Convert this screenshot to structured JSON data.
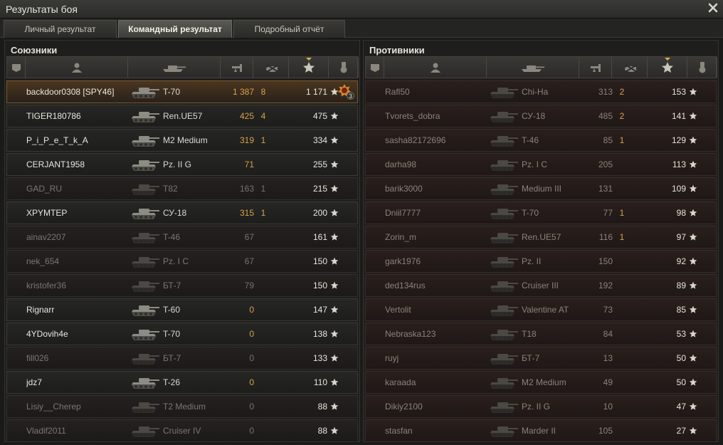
{
  "window": {
    "title": "Результаты боя",
    "close_icon": "close-icon"
  },
  "tabs": [
    {
      "label": "Личный результат",
      "active": false
    },
    {
      "label": "Командный результат",
      "active": true
    },
    {
      "label": "Подробный отчёт",
      "active": false
    }
  ],
  "columns": {
    "icons": [
      "platoon-icon",
      "player-icon",
      "vehicle-icon",
      "damage-icon",
      "kills-icon",
      "xp-icon",
      "medal-icon"
    ],
    "sorted_by": "xp"
  },
  "allies": {
    "title": "Союзники",
    "rows": [
      {
        "player": "backdoor0308 [SPY46]",
        "vehicle": "T-70",
        "damage": "1 387",
        "kills": "8",
        "xp": "1 171",
        "medal": "3",
        "self": true,
        "alive": true
      },
      {
        "player": "TIGER180786",
        "vehicle": "Ren.UE57",
        "damage": "425",
        "kills": "4",
        "xp": "475",
        "alive": true
      },
      {
        "player": "P_i_P_e_T_k_A",
        "vehicle": "M2 Medium",
        "damage": "319",
        "kills": "1",
        "xp": "334",
        "alive": true
      },
      {
        "player": "CERJANT1958",
        "vehicle": "Pz. II G",
        "damage": "71",
        "kills": "",
        "xp": "255",
        "alive": true
      },
      {
        "player": "GAD_RU",
        "vehicle": "T82",
        "damage": "163",
        "kills": "1",
        "xp": "215",
        "alive": false
      },
      {
        "player": "XPYMTEP",
        "vehicle": "СУ-18",
        "damage": "315",
        "kills": "1",
        "xp": "200",
        "alive": true
      },
      {
        "player": "ainav2207",
        "vehicle": "T-46",
        "damage": "67",
        "kills": "",
        "xp": "161",
        "alive": false
      },
      {
        "player": "nek_654",
        "vehicle": "Pz. I C",
        "damage": "67",
        "kills": "",
        "xp": "150",
        "alive": false
      },
      {
        "player": "kristofer36",
        "vehicle": "БТ-7",
        "damage": "79",
        "kills": "",
        "xp": "150",
        "alive": false
      },
      {
        "player": "Rignarr",
        "vehicle": "T-60",
        "damage": "0",
        "kills": "",
        "xp": "147",
        "alive": true
      },
      {
        "player": "4YDovih4e",
        "vehicle": "T-70",
        "damage": "0",
        "kills": "",
        "xp": "138",
        "alive": true
      },
      {
        "player": "fill026",
        "vehicle": "БТ-7",
        "damage": "0",
        "kills": "",
        "xp": "133",
        "alive": false
      },
      {
        "player": "jdz7",
        "vehicle": "T-26",
        "damage": "0",
        "kills": "",
        "xp": "110",
        "alive": true
      },
      {
        "player": "Lisiy__Cherep",
        "vehicle": "T2 Medium",
        "damage": "0",
        "kills": "",
        "xp": "88",
        "alive": false
      },
      {
        "player": "Vladif2011",
        "vehicle": "Cruiser IV",
        "damage": "0",
        "kills": "",
        "xp": "88",
        "alive": false
      }
    ]
  },
  "enemies": {
    "title": "Противники",
    "rows": [
      {
        "player": "Rafl50",
        "vehicle": "Chi-Ha",
        "damage": "313",
        "kills": "2",
        "xp": "153"
      },
      {
        "player": "Tvorets_dobra",
        "vehicle": "СУ-18",
        "damage": "485",
        "kills": "2",
        "xp": "141"
      },
      {
        "player": "sasha82172696",
        "vehicle": "T-46",
        "damage": "85",
        "kills": "1",
        "xp": "129"
      },
      {
        "player": "darha98",
        "vehicle": "Pz. I C",
        "damage": "205",
        "kills": "",
        "xp": "113"
      },
      {
        "player": "barik3000",
        "vehicle": "Medium III",
        "damage": "131",
        "kills": "",
        "xp": "109"
      },
      {
        "player": "Dniil7777",
        "vehicle": "T-70",
        "damage": "77",
        "kills": "1",
        "xp": "98"
      },
      {
        "player": "Zorin_m",
        "vehicle": "Ren.UE57",
        "damage": "116",
        "kills": "1",
        "xp": "97"
      },
      {
        "player": "gark1976",
        "vehicle": "Pz. II",
        "damage": "150",
        "kills": "",
        "xp": "92"
      },
      {
        "player": "ded134rus",
        "vehicle": "Cruiser III",
        "damage": "192",
        "kills": "",
        "xp": "89"
      },
      {
        "player": "Vertolit",
        "vehicle": "Valentine AT",
        "damage": "73",
        "kills": "",
        "xp": "85"
      },
      {
        "player": "Nebraska123",
        "vehicle": "T18",
        "damage": "84",
        "kills": "",
        "xp": "53"
      },
      {
        "player": "ruyj",
        "vehicle": "БТ-7",
        "damage": "13",
        "kills": "",
        "xp": "50"
      },
      {
        "player": "karaada",
        "vehicle": "M2 Medium",
        "damage": "49",
        "kills": "",
        "xp": "50"
      },
      {
        "player": "Dikiy2100",
        "vehicle": "Pz. II G",
        "damage": "10",
        "kills": "",
        "xp": "47"
      },
      {
        "player": "stasfan",
        "vehicle": "Marder II",
        "damage": "105",
        "kills": "",
        "xp": "27"
      }
    ]
  },
  "colors": {
    "accent": "#d6b24a",
    "highlight_value": "#d9a14a",
    "ally_row": "#262624",
    "enemy_row": "#2a1f1d",
    "self_row": "#4a3620"
  }
}
